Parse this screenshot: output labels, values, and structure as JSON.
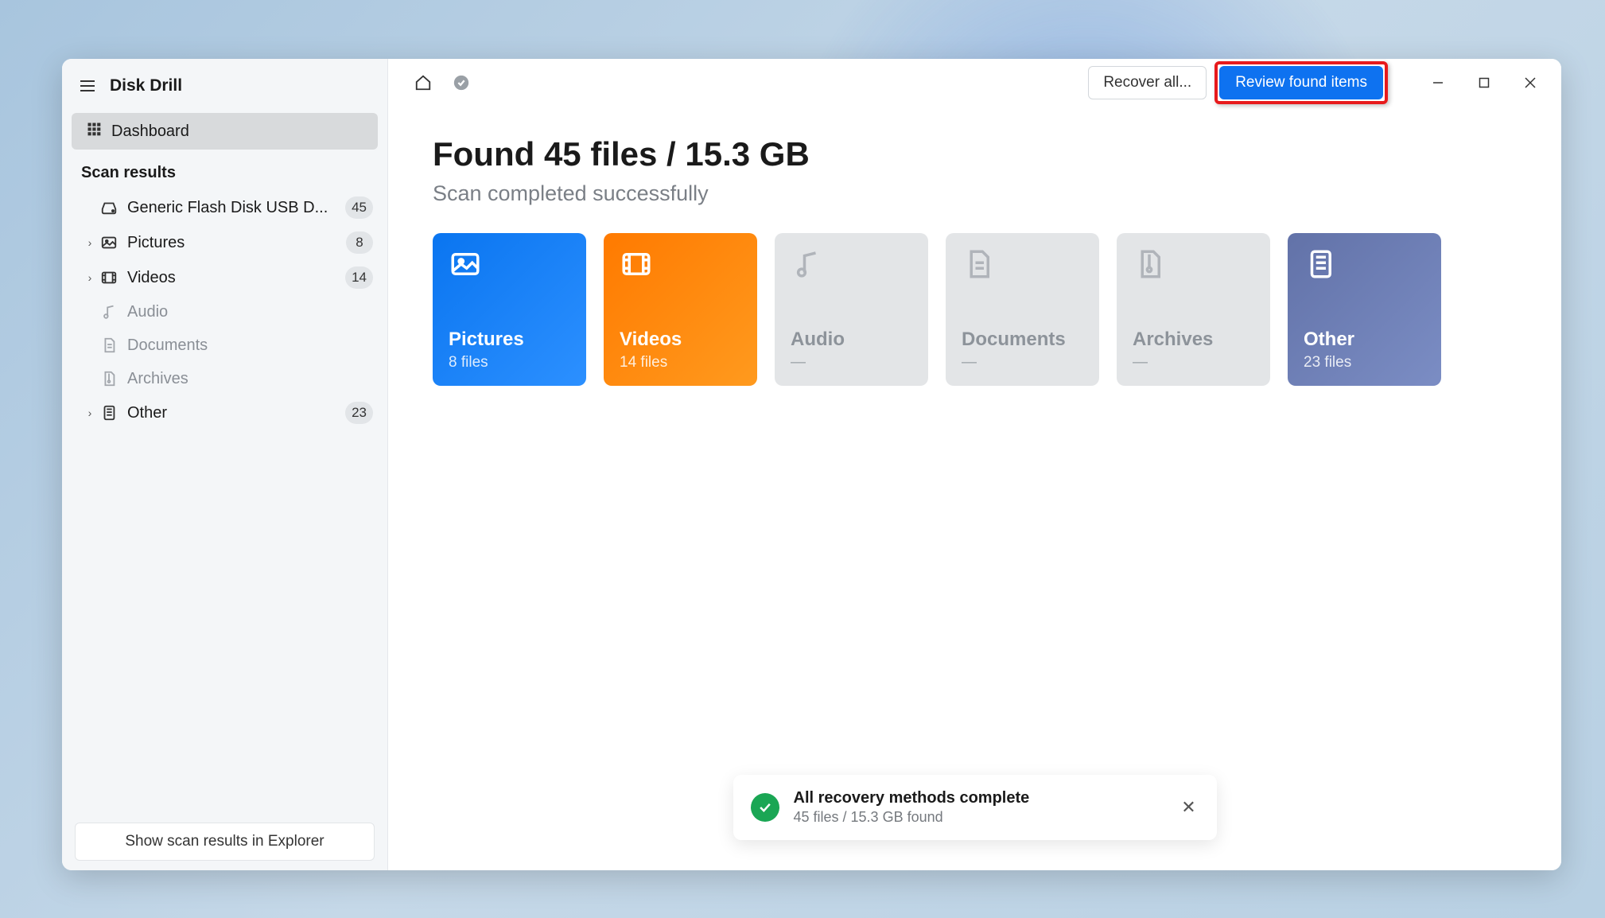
{
  "app": {
    "title": "Disk Drill"
  },
  "sidebar": {
    "dashboard_label": "Dashboard",
    "section_label": "Scan results",
    "items": [
      {
        "label": "Generic Flash Disk USB D...",
        "count": "45",
        "icon": "disk"
      },
      {
        "label": "Pictures",
        "count": "8",
        "icon": "picture",
        "expandable": true
      },
      {
        "label": "Videos",
        "count": "14",
        "icon": "video",
        "expandable": true
      },
      {
        "label": "Audio",
        "count": "",
        "icon": "audio",
        "dim": true
      },
      {
        "label": "Documents",
        "count": "",
        "icon": "document",
        "dim": true
      },
      {
        "label": "Archives",
        "count": "",
        "icon": "archive",
        "dim": true
      },
      {
        "label": "Other",
        "count": "23",
        "icon": "other",
        "expandable": true
      }
    ],
    "footer_button": "Show scan results in Explorer"
  },
  "topbar": {
    "recover_all": "Recover all...",
    "review": "Review found items"
  },
  "headline": "Found 45 files / 15.3 GB",
  "subhead": "Scan completed successfully",
  "tiles": [
    {
      "title": "Pictures",
      "sub": "8 files",
      "type": "pictures",
      "enabled": true
    },
    {
      "title": "Videos",
      "sub": "14 files",
      "type": "videos",
      "enabled": true
    },
    {
      "title": "Audio",
      "sub": "—",
      "type": "audio",
      "enabled": false
    },
    {
      "title": "Documents",
      "sub": "—",
      "type": "documents",
      "enabled": false
    },
    {
      "title": "Archives",
      "sub": "—",
      "type": "archives",
      "enabled": false
    },
    {
      "title": "Other",
      "sub": "23 files",
      "type": "other",
      "enabled": true
    }
  ],
  "toast": {
    "title": "All recovery methods complete",
    "sub": "45 files / 15.3 GB found"
  }
}
